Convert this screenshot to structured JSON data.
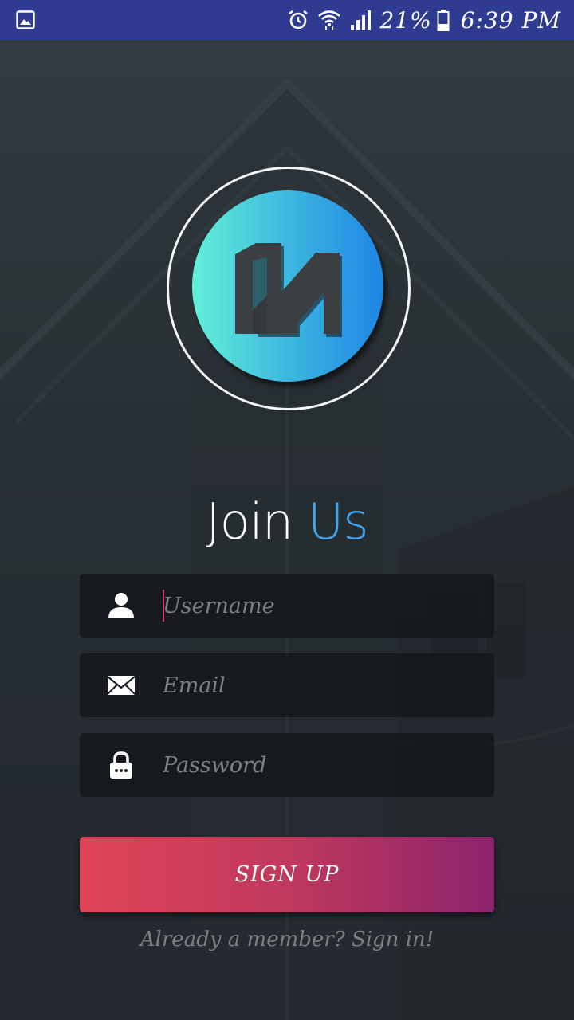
{
  "status_bar": {
    "battery_percent": "21%",
    "time": "6:39 PM",
    "icons": [
      "gallery-icon",
      "alarm-icon",
      "wifi-icon",
      "signal-icon",
      "battery-icon"
    ]
  },
  "logo": {
    "icon": "logo-icon",
    "gradient_start": "#62f0d8",
    "gradient_end": "#1f84e4"
  },
  "title": {
    "word1": "Join",
    "word2": "Us",
    "accent_color": "#42a4ec"
  },
  "form": {
    "username": {
      "placeholder": "Username",
      "value": "",
      "icon": "user-icon"
    },
    "email": {
      "placeholder": "Email",
      "value": "",
      "icon": "envelope-icon"
    },
    "password": {
      "placeholder": "Password",
      "value": "",
      "icon": "lock-icon"
    }
  },
  "signup_button": {
    "label": "SIGN UP",
    "gradient_start": "#df4456",
    "gradient_end": "#8b246c"
  },
  "signin_link": {
    "label": "Already a member? Sign in!"
  }
}
